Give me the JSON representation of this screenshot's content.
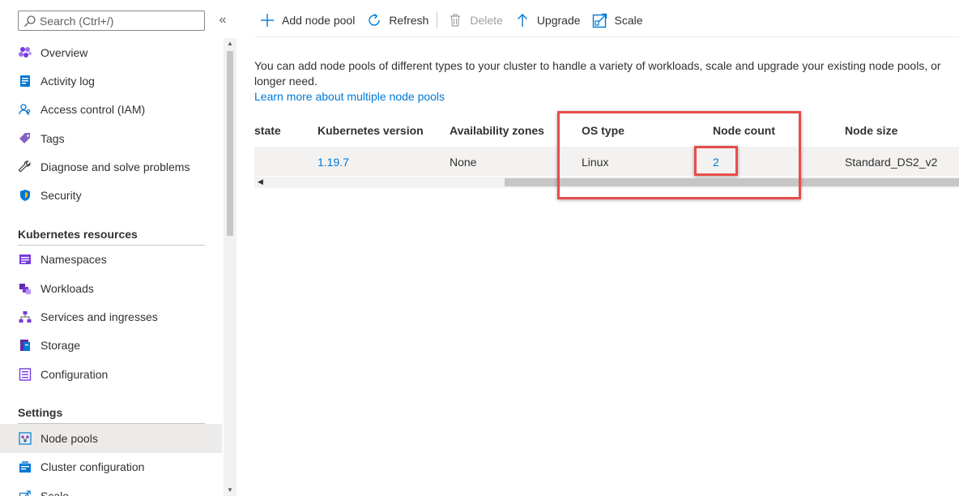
{
  "search": {
    "placeholder": "Search (Ctrl+/)"
  },
  "collapse": {
    "glyph": "«"
  },
  "nav": {
    "top_items": [
      {
        "label": "Overview",
        "icon": "overview-icon"
      },
      {
        "label": "Activity log",
        "icon": "activity-log-icon"
      },
      {
        "label": "Access control (IAM)",
        "icon": "access-control-icon"
      },
      {
        "label": "Tags",
        "icon": "tag-icon"
      },
      {
        "label": "Diagnose and solve problems",
        "icon": "wrench-icon"
      },
      {
        "label": "Security",
        "icon": "shield-icon"
      }
    ],
    "kubernetes_section": "Kubernetes resources",
    "kubernetes_items": [
      {
        "label": "Namespaces",
        "icon": "namespaces-icon"
      },
      {
        "label": "Workloads",
        "icon": "workloads-icon"
      },
      {
        "label": "Services and ingresses",
        "icon": "services-icon"
      },
      {
        "label": "Storage",
        "icon": "storage-icon"
      },
      {
        "label": "Configuration",
        "icon": "configuration-icon"
      }
    ],
    "settings_section": "Settings",
    "settings_items": [
      {
        "label": "Node pools",
        "icon": "node-pools-icon",
        "selected": true
      },
      {
        "label": "Cluster configuration",
        "icon": "cluster-configuration-icon"
      },
      {
        "label": "Scale",
        "icon": "scale-icon"
      }
    ]
  },
  "toolbar": {
    "add_node_pool": "Add node pool",
    "refresh": "Refresh",
    "delete": "Delete",
    "upgrade": "Upgrade",
    "scale": "Scale"
  },
  "main": {
    "description": "You can add node pools of different types to your cluster to handle a variety of workloads, scale and upgrade your existing node pools, or longer need.",
    "learn_more": "Learn more about multiple node pools"
  },
  "table": {
    "columns": [
      "state",
      "Kubernetes version",
      "Availability zones",
      "OS type",
      "Node count",
      "Node size"
    ],
    "rows": [
      {
        "state": "",
        "kubernetes_version": "1.19.7",
        "availability_zones": "None",
        "os_type": "Linux",
        "node_count": "2",
        "node_size": "Standard_DS2_v2"
      }
    ]
  },
  "colors": {
    "accent": "#0078d4",
    "highlight": "#e74c4c",
    "selected_bg": "#edebe9"
  }
}
